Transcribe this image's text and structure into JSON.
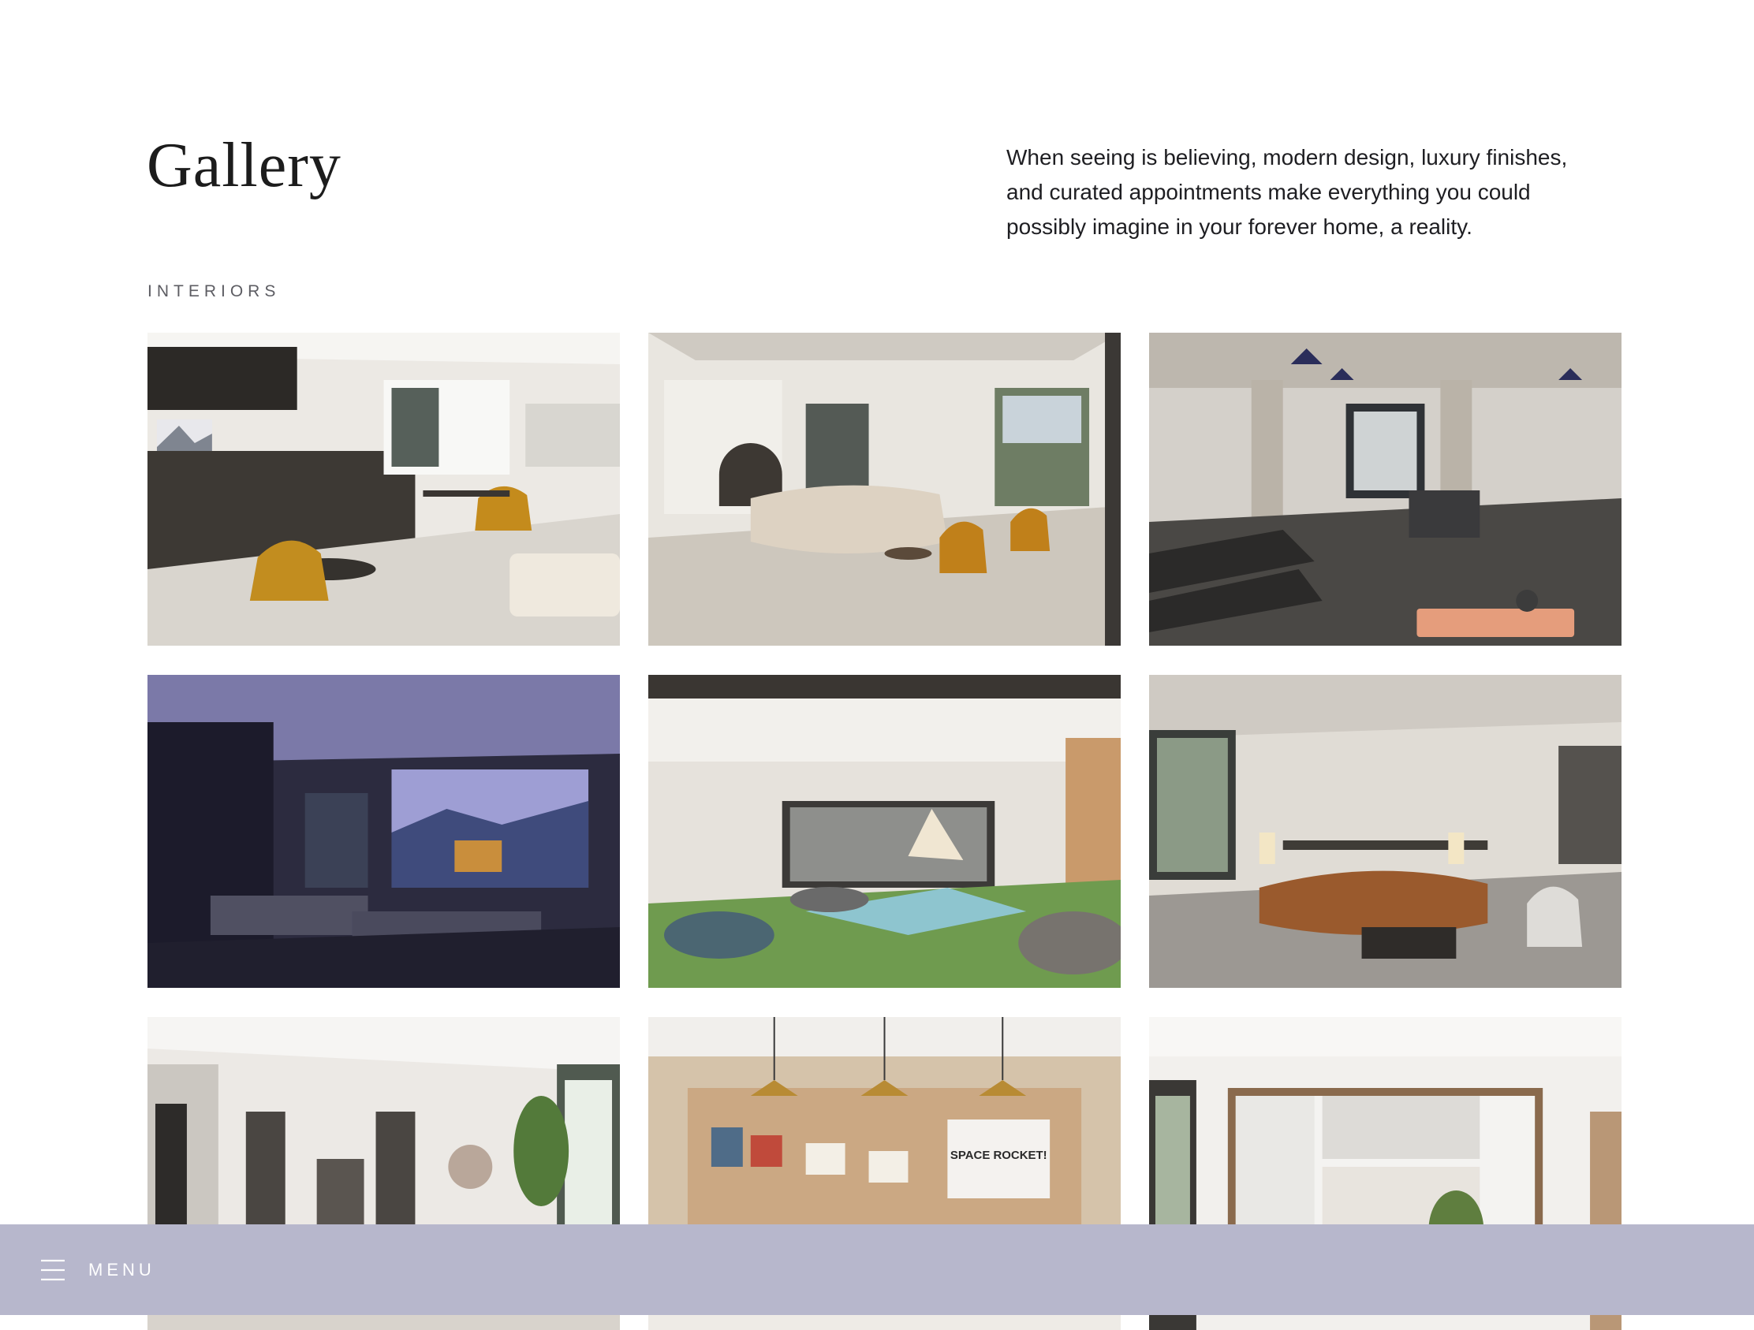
{
  "page": {
    "title": "Gallery",
    "intro": "When seeing is believing, modern design, luxury finishes, and curated appointments make everything you could possibly imagine in your forever home, a reality.",
    "section_label": "INTERIORS"
  },
  "gallery": {
    "images": [
      {
        "name": "lounge-kitchen-photo"
      },
      {
        "name": "living-room-photo"
      },
      {
        "name": "fitness-center-photo"
      },
      {
        "name": "screening-room-photo"
      },
      {
        "name": "playroom-photo"
      },
      {
        "name": "club-lounge-photo"
      },
      {
        "name": "lobby-photo"
      },
      {
        "name": "craft-room-photo",
        "sign_text": "SPACE ROCKET!"
      },
      {
        "name": "residence-kitchen-photo"
      }
    ]
  },
  "menu": {
    "label": "MENU",
    "icon": "hamburger-icon"
  },
  "colors": {
    "menu_bar": "#b7b7cc",
    "text": "#1e1e22",
    "label": "#5d5d63"
  }
}
